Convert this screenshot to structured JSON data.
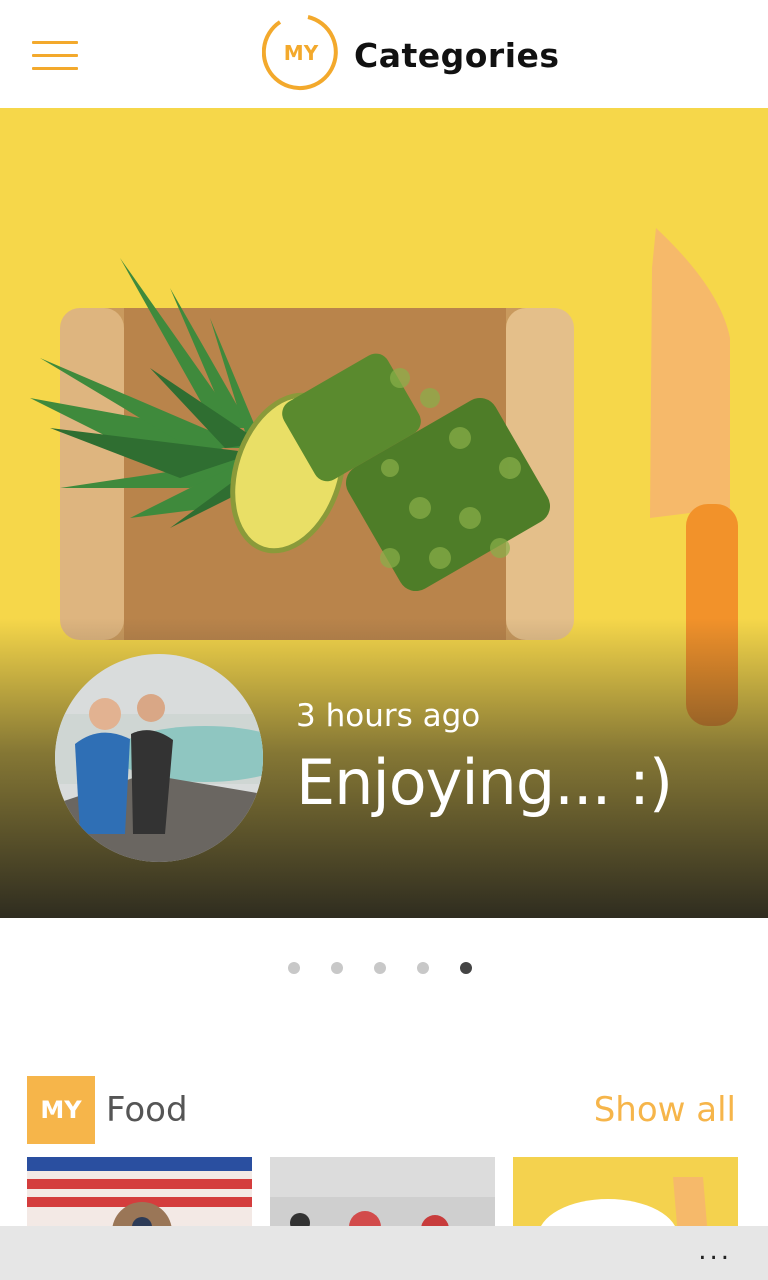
{
  "header": {
    "logo_text": "MY",
    "title": "Categories",
    "menu_icon": "hamburger-menu-icon",
    "accent_color": "#f3a92c"
  },
  "hero": {
    "time": "3 hours ago",
    "caption": "Enjoying... :)",
    "background_color": "#f6d74a"
  },
  "carousel": {
    "dot_count": 5,
    "active_index": 4
  },
  "section": {
    "badge": "MY",
    "title": "Food",
    "show_all": "Show all",
    "badge_color": "#f6b54a"
  },
  "app_bar": {
    "more_label": "..."
  }
}
